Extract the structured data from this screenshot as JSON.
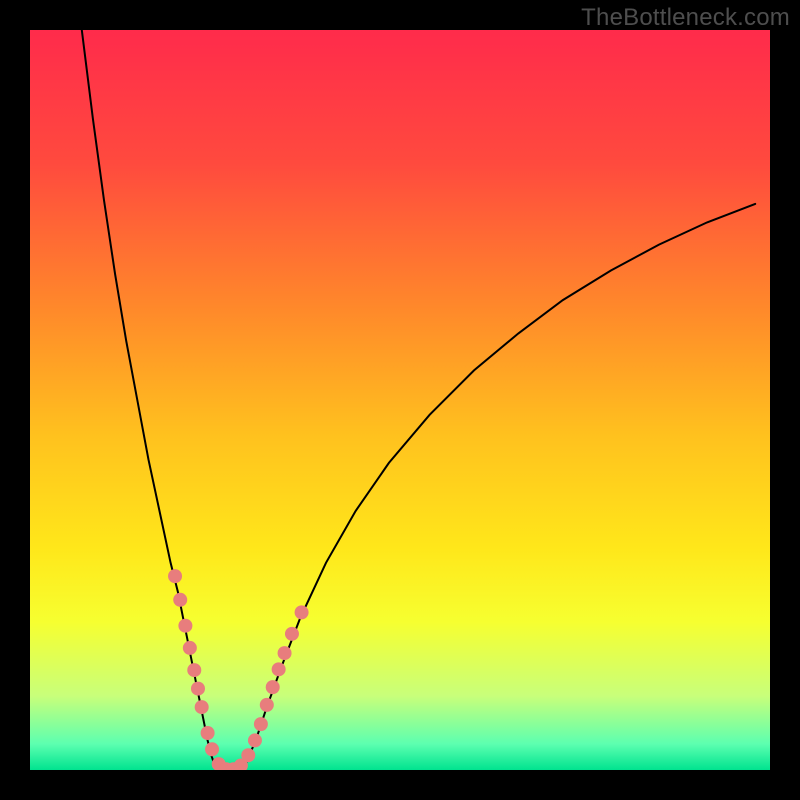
{
  "watermark": "TheBottleneck.com",
  "frame": {
    "outer_size": 800,
    "inner_origin": 30,
    "inner_size": 740,
    "border_color": "#000000"
  },
  "gradient": {
    "stops": [
      {
        "offset": 0.0,
        "color": "#ff2b4b"
      },
      {
        "offset": 0.18,
        "color": "#ff4a3e"
      },
      {
        "offset": 0.38,
        "color": "#ff8a2a"
      },
      {
        "offset": 0.55,
        "color": "#ffc21e"
      },
      {
        "offset": 0.7,
        "color": "#ffe71a"
      },
      {
        "offset": 0.8,
        "color": "#f6ff30"
      },
      {
        "offset": 0.9,
        "color": "#c8ff7a"
      },
      {
        "offset": 0.965,
        "color": "#5cffb0"
      },
      {
        "offset": 1.0,
        "color": "#00e38f"
      }
    ]
  },
  "chart_data": {
    "type": "line",
    "title": "",
    "xlabel": "",
    "ylabel": "",
    "xlim": [
      0,
      100
    ],
    "ylim": [
      0,
      100
    ],
    "curve_color": "#000000",
    "curve_width": 2,
    "series": [
      {
        "name": "left-branch",
        "x": [
          7.0,
          8.5,
          10.0,
          11.5,
          13.0,
          14.5,
          16.0,
          17.5,
          19.0,
          20.0,
          21.0,
          22.0,
          22.8,
          23.5,
          24.0,
          24.5,
          25.0
        ],
        "y": [
          100.0,
          88.0,
          77.0,
          67.0,
          58.0,
          50.0,
          42.0,
          35.0,
          28.0,
          24.0,
          19.0,
          14.0,
          10.0,
          6.5,
          4.0,
          2.0,
          0.5
        ]
      },
      {
        "name": "valley",
        "x": [
          25.0,
          25.8,
          26.6,
          27.4,
          28.2,
          29.0
        ],
        "y": [
          0.5,
          0.1,
          0.0,
          0.0,
          0.1,
          0.5
        ]
      },
      {
        "name": "right-branch",
        "x": [
          29.0,
          30.5,
          32.0,
          34.0,
          36.5,
          40.0,
          44.0,
          48.5,
          54.0,
          60.0,
          66.0,
          72.0,
          78.5,
          85.0,
          91.5,
          98.0
        ],
        "y": [
          0.5,
          4.0,
          8.5,
          14.0,
          20.5,
          28.0,
          35.0,
          41.5,
          48.0,
          54.0,
          59.0,
          63.5,
          67.5,
          71.0,
          74.0,
          76.5
        ]
      }
    ],
    "scatter": {
      "name": "highlight-dots",
      "color": "#e87d7d",
      "radius": 7,
      "points": [
        {
          "x": 19.6,
          "y": 26.2
        },
        {
          "x": 20.3,
          "y": 23.0
        },
        {
          "x": 21.0,
          "y": 19.5
        },
        {
          "x": 21.6,
          "y": 16.5
        },
        {
          "x": 22.2,
          "y": 13.5
        },
        {
          "x": 22.7,
          "y": 11.0
        },
        {
          "x": 23.2,
          "y": 8.5
        },
        {
          "x": 24.0,
          "y": 5.0
        },
        {
          "x": 24.6,
          "y": 2.8
        },
        {
          "x": 25.5,
          "y": 0.8
        },
        {
          "x": 26.5,
          "y": 0.1
        },
        {
          "x": 27.5,
          "y": 0.1
        },
        {
          "x": 28.5,
          "y": 0.6
        },
        {
          "x": 29.5,
          "y": 2.0
        },
        {
          "x": 30.4,
          "y": 4.0
        },
        {
          "x": 31.2,
          "y": 6.2
        },
        {
          "x": 32.0,
          "y": 8.8
        },
        {
          "x": 32.8,
          "y": 11.2
        },
        {
          "x": 33.6,
          "y": 13.6
        },
        {
          "x": 34.4,
          "y": 15.8
        },
        {
          "x": 35.4,
          "y": 18.4
        },
        {
          "x": 36.7,
          "y": 21.3
        }
      ]
    }
  }
}
